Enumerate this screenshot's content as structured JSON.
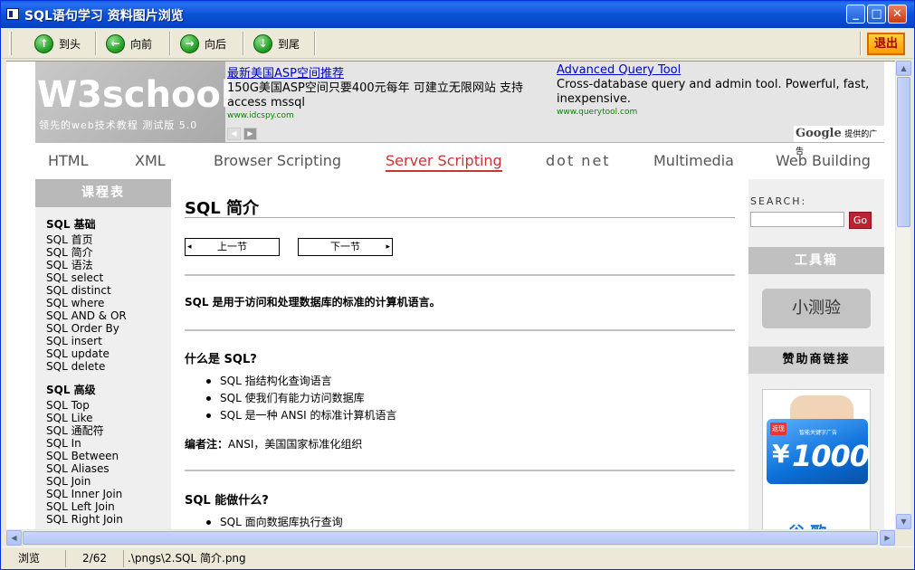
{
  "window": {
    "title": "SQL语句学习 资料图片浏览",
    "min_glyph": "_",
    "max_glyph": "□",
    "close_glyph": "✕"
  },
  "toolbar": {
    "first": "到头",
    "prev": "向前",
    "next": "向后",
    "last": "到尾",
    "exit": "退出"
  },
  "status": {
    "mode": "浏览",
    "position": "2/62",
    "path": ".\\pngs\\2.SQL 简介.png"
  },
  "page": {
    "logo_big": "W3school",
    "logo_small": "领先的web技术教程 测试版 5.0",
    "ads": [
      {
        "title": "最新美国ASP空间推荐",
        "text": "150G美国ASP空间只要400元每年 可建立无限网站 支持access mssql",
        "url": "www.idcspy.com"
      },
      {
        "title": "Advanced Query Tool",
        "text": "Cross-database query and admin tool. Powerful, fast, inexpensive.",
        "url": "www.querytool.com"
      }
    ],
    "ad_label_google": "Google",
    "ad_label_suffix": "提供的广告",
    "nav": [
      "HTML",
      "XML",
      "Browser Scripting",
      "Server Scripting",
      "dot net",
      "Multimedia",
      "Web Building"
    ],
    "nav_active": "Server Scripting",
    "sidebar": {
      "head": "课程表",
      "group1": "SQL 基础",
      "basics": [
        "SQL 首页",
        "SQL 简介",
        "SQL 语法",
        "SQL select",
        "SQL distinct",
        "SQL where",
        "SQL AND & OR",
        "SQL Order By",
        "SQL insert",
        "SQL update",
        "SQL delete"
      ],
      "group2": "SQL 高级",
      "advanced": [
        "SQL Top",
        "SQL Like",
        "SQL 通配符",
        "SQL In",
        "SQL Between",
        "SQL Aliases",
        "SQL Join",
        "SQL Inner Join",
        "SQL Left Join",
        "SQL Right Join"
      ]
    },
    "main": {
      "title": "SQL 简介",
      "prev": "上一节",
      "next": "下一节",
      "intro": "SQL 是用于访问和处理数据库的标准的计算机语言。",
      "h_what": "什么是 SQL?",
      "what_items": [
        "SQL 指结构化查询语言",
        "SQL 使我们有能力访问数据库",
        "SQL 是一种 ANSI 的标准计算机语言"
      ],
      "note_label": "编者注：",
      "note_text": "ANSI，美国国家标准化组织",
      "h_can": "SQL 能做什么?",
      "can_items": [
        "SQL 面向数据库执行查询"
      ]
    },
    "right": {
      "search_label": "SEARCH:",
      "go": "Go",
      "toolbox": "工具箱",
      "quiz": "小测验",
      "sponsor": "赞助商链接",
      "card_tag": "返现",
      "card_yen": "¥",
      "card_amount": "1000",
      "card_sub": "智能关键字广告",
      "sponsor_bottom": "谷 歌"
    }
  }
}
